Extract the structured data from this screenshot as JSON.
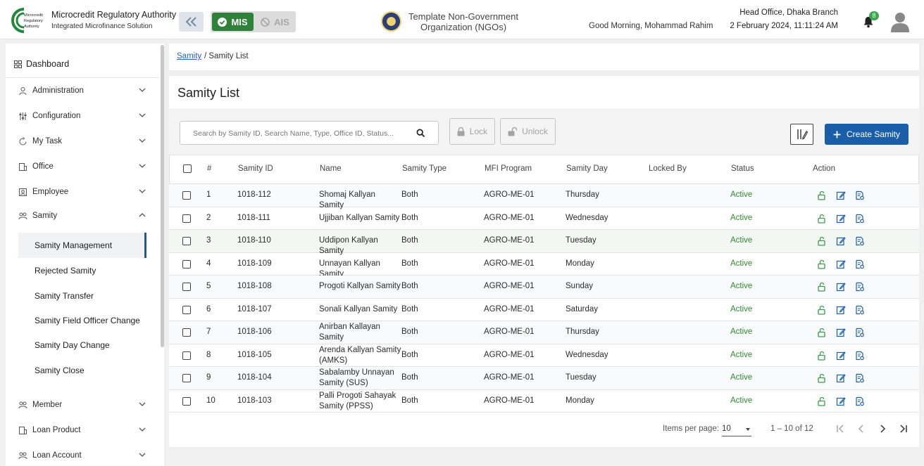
{
  "app": {
    "org_name": "Microcredit Regulatory Authority",
    "org_subtitle": "Integrated Microfinance Solution",
    "logo_text": [
      "Microcredit",
      "Regulatory",
      "Authority"
    ],
    "mis_label": "MIS",
    "ais_label": "AIS",
    "ngo_name": "Template Non-Government Organization (NGOs)",
    "greeting": "Good Morning, Mohammad Rahim",
    "branch": "Head Office, Dhaka Branch",
    "datetime": "2 February 2024, 11:11:24 AM",
    "notification_count": "8"
  },
  "sidebar": {
    "dashboard": "Dashboard",
    "items": [
      {
        "label": "Administration",
        "icon": "admin-icon"
      },
      {
        "label": "Configuration",
        "icon": "config-icon"
      },
      {
        "label": "My Task",
        "icon": "task-icon"
      },
      {
        "label": "Office",
        "icon": "office-icon"
      },
      {
        "label": "Employee",
        "icon": "employee-icon"
      },
      {
        "label": "Samity",
        "icon": "samity-icon"
      },
      {
        "label": "Member",
        "icon": "member-icon"
      },
      {
        "label": "Loan Product",
        "icon": "loan-product-icon"
      },
      {
        "label": "Loan Account",
        "icon": "loan-account-icon"
      }
    ],
    "samity_sub": [
      "Samity Management",
      "Rejected Samity",
      "Samity Transfer",
      "Samity Field Officer Change",
      "Samity Day Change",
      "Samity Close"
    ]
  },
  "breadcrumb": {
    "link": "Samity",
    "current": "/ Samity List"
  },
  "page": {
    "title": "Samity List",
    "search_placeholder": "Search by Samity ID, Search Name, Type, Office ID, Status...",
    "lock_label": "Lock",
    "unlock_label": "Unlock",
    "create_label": "Create Samity"
  },
  "table": {
    "headers": [
      "#",
      "Samity ID",
      "Name",
      "Samity Type",
      "MFI Program",
      "Samity Day",
      "Locked By",
      "Status",
      "Action"
    ],
    "rows": [
      {
        "n": "1",
        "id": "1018-112",
        "name": "Shomaj Kallyan Samity",
        "type": "Both",
        "program": "AGRO-ME-01",
        "day": "Thursday",
        "locked_by": "",
        "status": "Active"
      },
      {
        "n": "2",
        "id": "1018-111",
        "name": "Ujjiban Kallyan Samity",
        "type": "Both",
        "program": "AGRO-ME-01",
        "day": "Wednesday",
        "locked_by": "",
        "status": "Active"
      },
      {
        "n": "3",
        "id": "1018-110",
        "name": "Uddipon Kallyan Samity",
        "type": "Both",
        "program": "AGRO-ME-01",
        "day": "Tuesday",
        "locked_by": "",
        "status": "Active"
      },
      {
        "n": "4",
        "id": "1018-109",
        "name": "Unnayan Kallyan Samity",
        "type": "Both",
        "program": "AGRO-ME-01",
        "day": "Monday",
        "locked_by": "",
        "status": "Active"
      },
      {
        "n": "5",
        "id": "1018-108",
        "name": "Progoti Kallyan Samity",
        "type": "Both",
        "program": "AGRO-ME-01",
        "day": "Sunday",
        "locked_by": "",
        "status": "Active"
      },
      {
        "n": "6",
        "id": "1018-107",
        "name": "Sonali Kallyan Samity",
        "type": "Both",
        "program": "AGRO-ME-01",
        "day": "Saturday",
        "locked_by": "",
        "status": "Active"
      },
      {
        "n": "7",
        "id": "1018-106",
        "name": "Anirban Kallayan Samity",
        "type": "Both",
        "program": "AGRO-ME-01",
        "day": "Thursday",
        "locked_by": "",
        "status": "Active"
      },
      {
        "n": "8",
        "id": "1018-105",
        "name": "Arenda Kallyan Samity (AMKS)",
        "type": "Both",
        "program": "AGRO-ME-01",
        "day": "Wednesday",
        "locked_by": "",
        "status": "Active"
      },
      {
        "n": "9",
        "id": "1018-104",
        "name": "Sabalamby Unnayan Samity (SUS)",
        "type": "Both",
        "program": "AGRO-ME-01",
        "day": "Tuesday",
        "locked_by": "",
        "status": "Active"
      },
      {
        "n": "10",
        "id": "1018-103",
        "name": "Palli Progoti Sahayak Samity (PPSS)",
        "type": "Both",
        "program": "AGRO-ME-01",
        "day": "Monday",
        "locked_by": "",
        "status": "Active"
      }
    ]
  },
  "pagination": {
    "items_per_page_label": "Items per page:",
    "items_per_page": "10",
    "range": "1 – 10 of 12"
  },
  "colors": {
    "primary": "#1a5ea8",
    "mis_green": "#2f8038",
    "status_active": "#2f8a2f",
    "action_green": "#3a9a4a",
    "action_blue": "#1a5ea8"
  }
}
